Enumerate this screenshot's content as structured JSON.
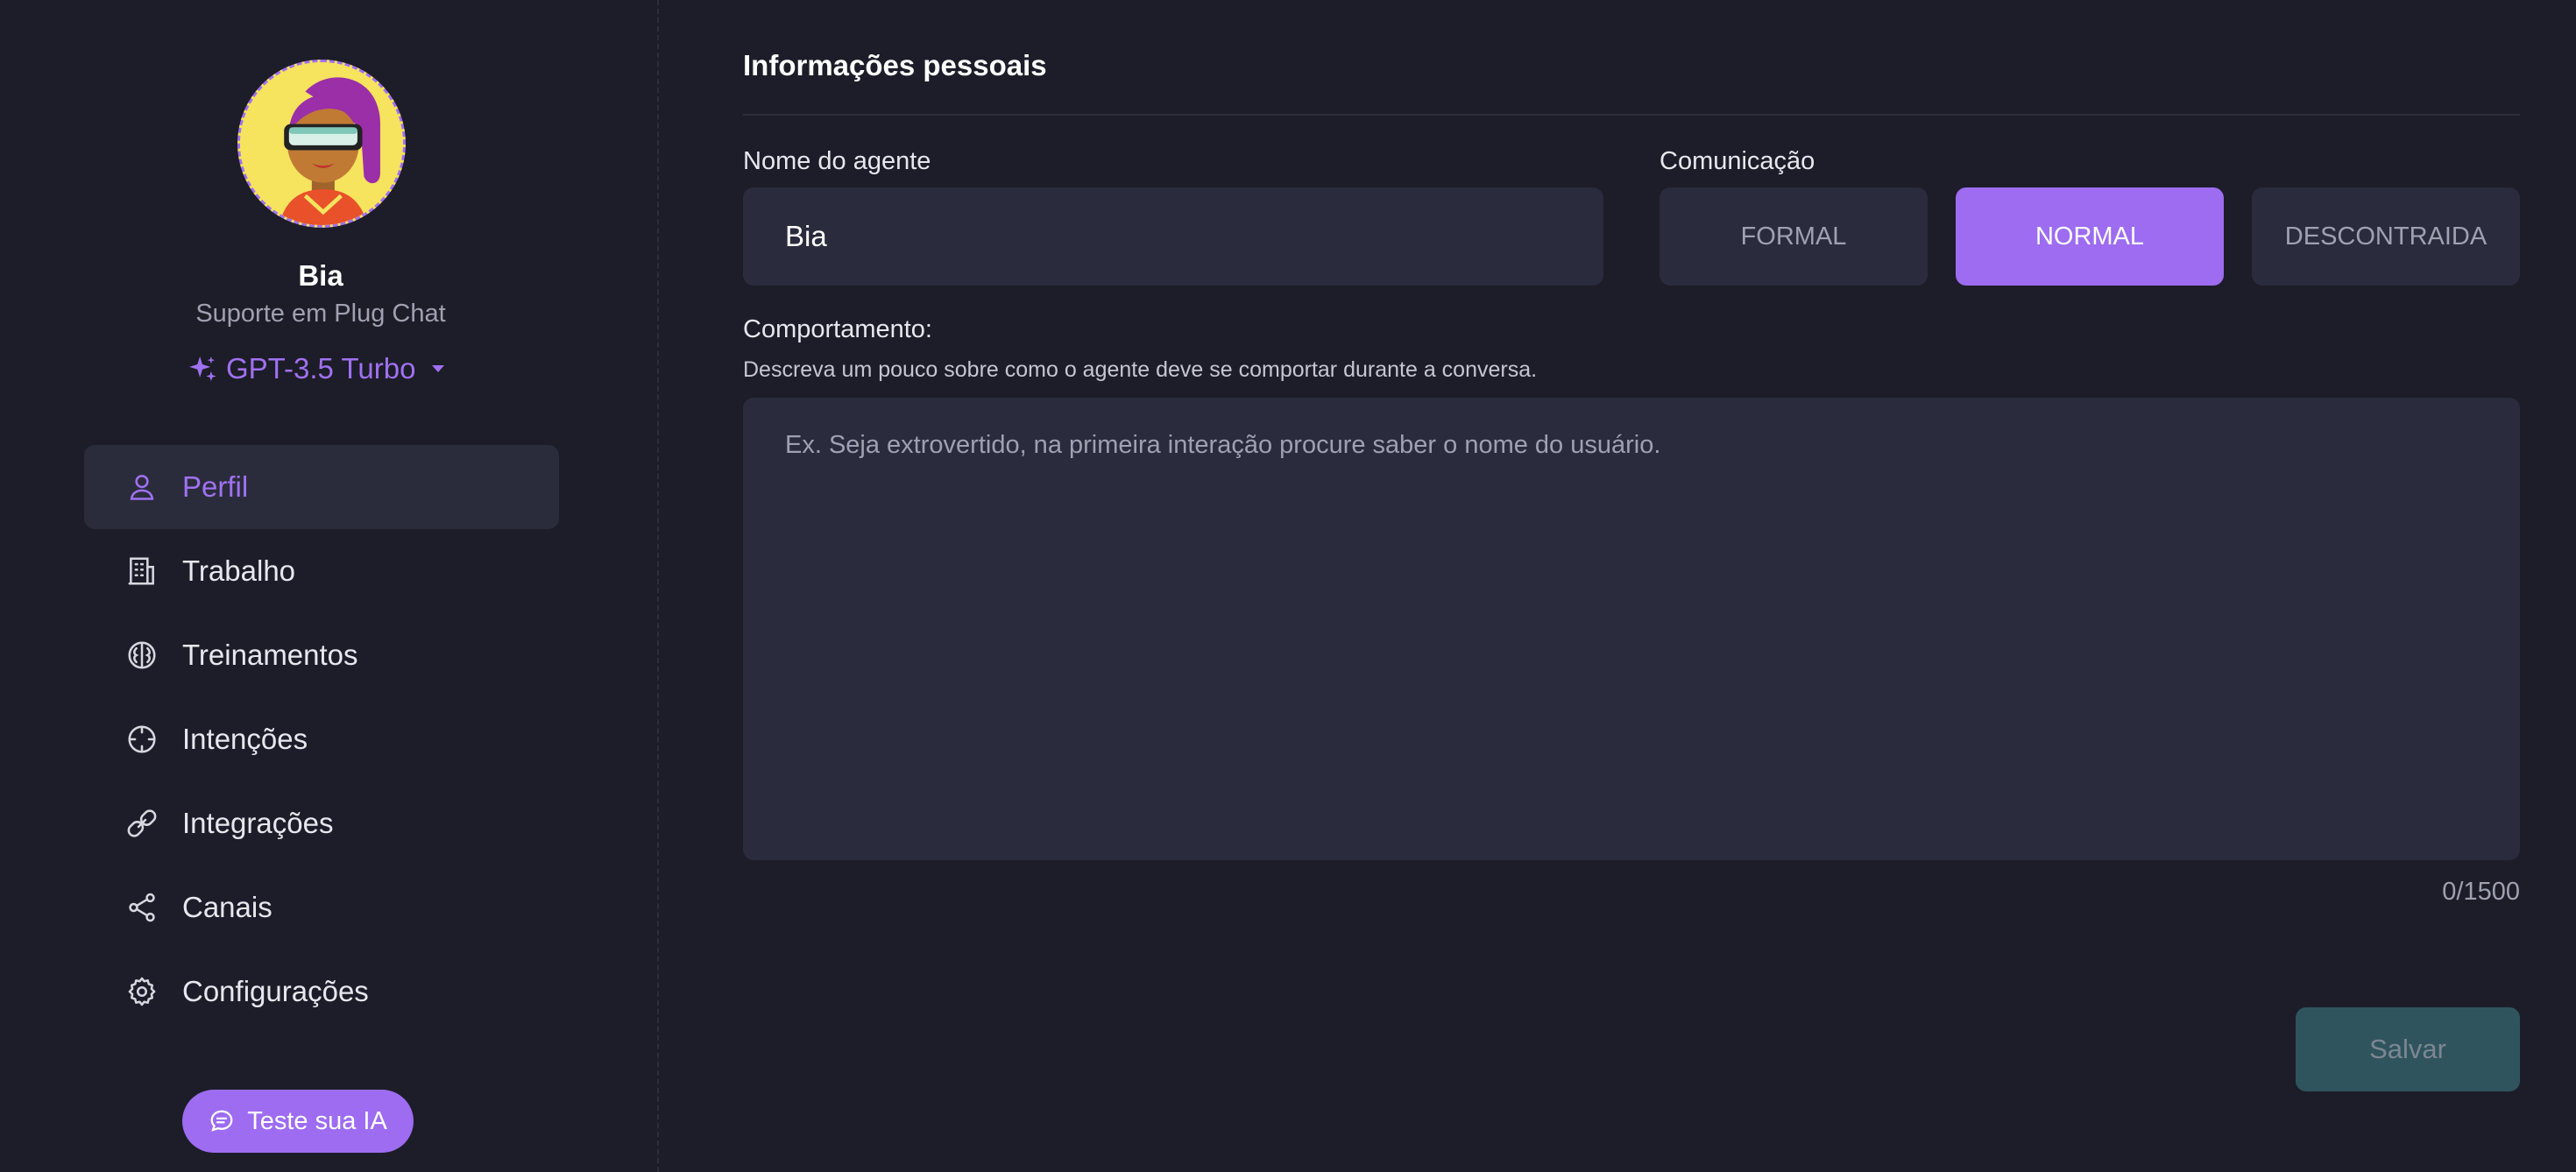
{
  "colors": {
    "accent": "#9d6cf1",
    "background": "#1c1d28",
    "surface": "#2a2b3c",
    "save_disabled": "#2f545e"
  },
  "agent": {
    "name": "Bia",
    "role": "Suporte em Plug Chat",
    "model": "GPT-3.5 Turbo",
    "avatar_icon": "avatar-woman-sunglasses"
  },
  "sidebar": {
    "items": [
      {
        "label": "Perfil",
        "icon": "user-icon",
        "active": true
      },
      {
        "label": "Trabalho",
        "icon": "building-icon",
        "active": false
      },
      {
        "label": "Treinamentos",
        "icon": "brain-icon",
        "active": false
      },
      {
        "label": "Intenções",
        "icon": "crosshair-icon",
        "active": false
      },
      {
        "label": "Integrações",
        "icon": "link-icon",
        "active": false
      },
      {
        "label": "Canais",
        "icon": "share-icon",
        "active": false
      },
      {
        "label": "Configurações",
        "icon": "gear-icon",
        "active": false
      }
    ],
    "test_button": "Teste sua IA"
  },
  "main": {
    "section_title": "Informações pessoais",
    "name_field": {
      "label": "Nome do agente",
      "value": "Bia"
    },
    "communication": {
      "label": "Comunicação",
      "options": [
        "FORMAL",
        "NORMAL",
        "DESCONTRAIDA"
      ],
      "selected": "NORMAL"
    },
    "behavior": {
      "label": "Comportamento:",
      "hint": "Descreva um pouco sobre como o agente deve se comportar durante a conversa.",
      "placeholder": "Ex. Seja extrovertido, na primeira interação procure saber o nome do usuário.",
      "value": "",
      "counter": "0/1500"
    },
    "save_label": "Salvar"
  }
}
